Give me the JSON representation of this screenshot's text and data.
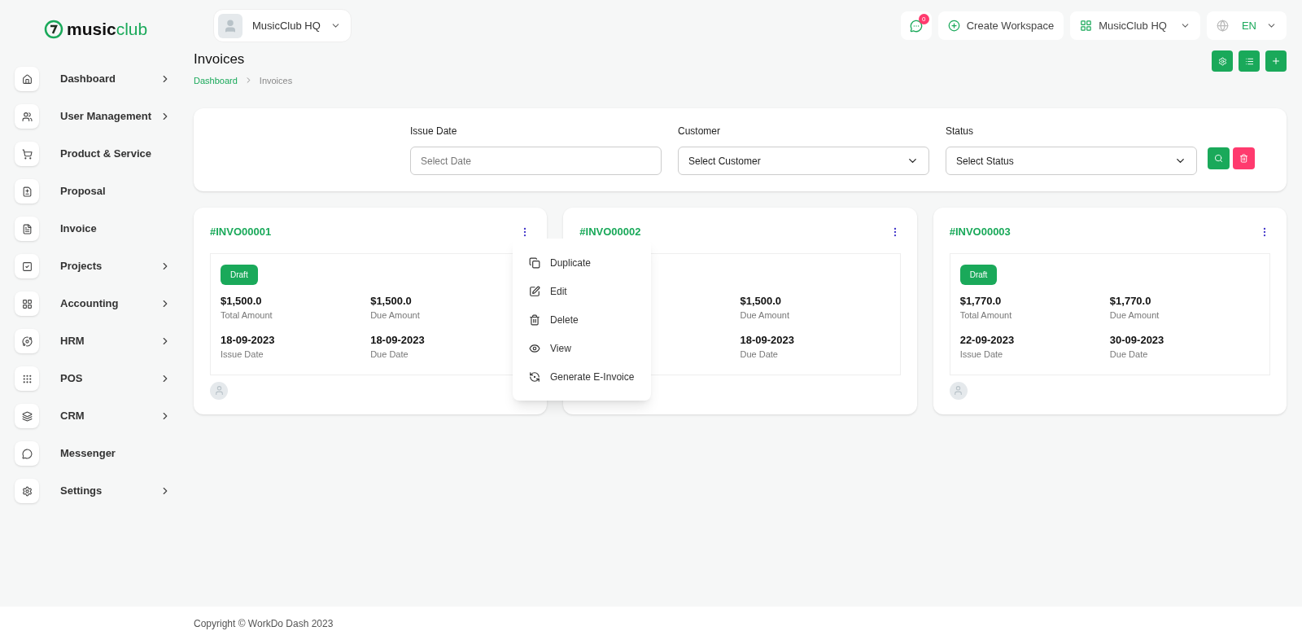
{
  "logo": {
    "text_bold": "music",
    "text_light": "club"
  },
  "workspace_selector": {
    "label": "MusicClub HQ"
  },
  "header": {
    "notification_count": "0",
    "create_workspace": "Create Workspace",
    "workspace": "MusicClub HQ",
    "language": "EN"
  },
  "sidebar": {
    "items": [
      {
        "label": "Dashboard",
        "has_children": true
      },
      {
        "label": "User Management",
        "has_children": true
      },
      {
        "label": "Product & Service",
        "has_children": false
      },
      {
        "label": "Proposal",
        "has_children": false
      },
      {
        "label": "Invoice",
        "has_children": false
      },
      {
        "label": "Projects",
        "has_children": true
      },
      {
        "label": "Accounting",
        "has_children": true
      },
      {
        "label": "HRM",
        "has_children": true
      },
      {
        "label": "POS",
        "has_children": true
      },
      {
        "label": "CRM",
        "has_children": true
      },
      {
        "label": "Messenger",
        "has_children": false
      },
      {
        "label": "Settings",
        "has_children": true
      }
    ]
  },
  "page": {
    "title": "Invoices",
    "breadcrumb": [
      {
        "label": "Dashboard",
        "kind": "link"
      },
      {
        "label": "Invoices",
        "kind": "current"
      }
    ]
  },
  "filters": [
    {
      "label": "Issue Date",
      "placeholder": "Select Date",
      "kind": "input"
    },
    {
      "label": "Customer",
      "placeholder": "Select Customer",
      "kind": "select"
    },
    {
      "label": "Status",
      "placeholder": "Select Status",
      "kind": "select"
    }
  ],
  "cards": [
    {
      "number": "#INVO00001",
      "status": "Draft",
      "total_amount": "$1,500.0",
      "total_label": "Total Amount",
      "due_amount": "$1,500.0",
      "due_label": "Due Amount",
      "issue_date": "18-09-2023",
      "issue_label": "Issue Date",
      "due_date": "18-09-2023",
      "due_date_label": "Due Date"
    },
    {
      "number": "#INVO00002",
      "due_amount": "$1,500.0",
      "due_label": "Due Amount",
      "due_date": "18-09-2023",
      "due_date_label": "Due Date"
    },
    {
      "number": "#INVO00003",
      "status": "Draft",
      "total_amount": "$1,770.0",
      "total_label": "Total Amount",
      "due_amount": "$1,770.0",
      "due_label": "Due Amount",
      "issue_date": "22-09-2023",
      "issue_label": "Issue Date",
      "due_date": "30-09-2023",
      "due_date_label": "Due Date"
    }
  ],
  "card_menu": {
    "items": [
      {
        "label": "Duplicate"
      },
      {
        "label": "Edit"
      },
      {
        "label": "Delete"
      },
      {
        "label": "View"
      },
      {
        "label": "Generate E-Invoice"
      }
    ]
  },
  "footer": {
    "text": "Copyright © WorkDo Dash 2023"
  }
}
